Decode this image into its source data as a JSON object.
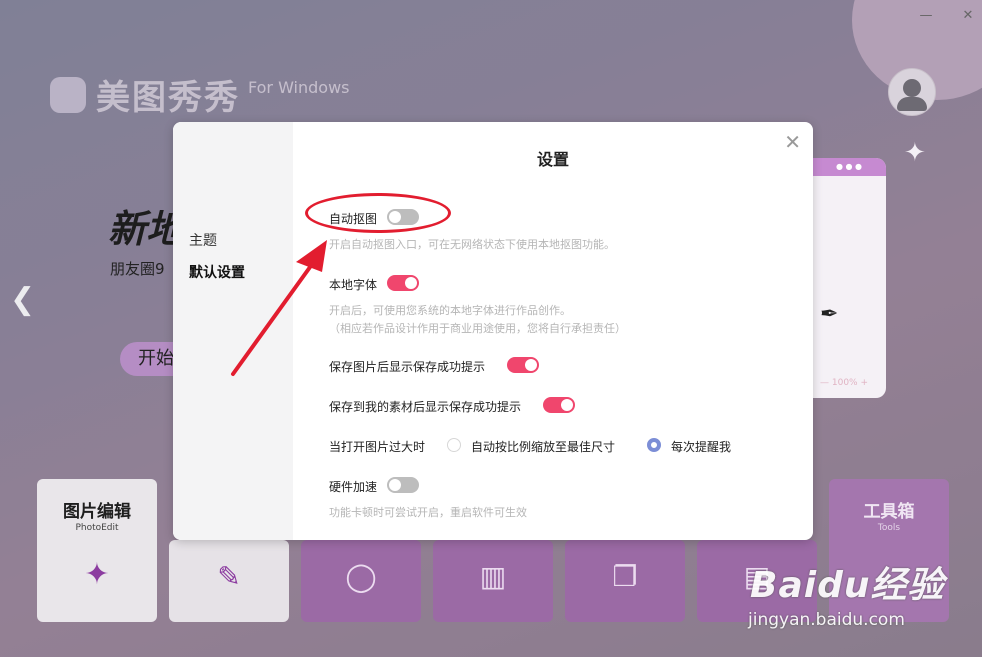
{
  "window": {
    "minimize_icon": "minimize-icon",
    "close_icon": "close-icon"
  },
  "app": {
    "logo_name": "美图秀秀",
    "logo_sub": "For Windows"
  },
  "banner": {
    "title": "新地",
    "subtitle": "朋友圈9",
    "start_button": "开始"
  },
  "preview": {
    "zoom_text": "— 100% +"
  },
  "tools": {
    "photo_edit_title": "图片编辑",
    "photo_edit_sub": "PhotoEdit",
    "toolbox_title": "工具箱",
    "toolbox_sub": "Tools"
  },
  "settings": {
    "title": "设置",
    "sidebar": [
      "主题",
      "默认设置"
    ],
    "auto_cutout_label": "自动抠图",
    "auto_cutout_on": false,
    "auto_cutout_desc": "开启自动抠图入口，可在无网络状态下使用本地抠图功能。",
    "local_font_label": "本地字体",
    "local_font_on": true,
    "local_font_desc1": "开启后，可使用您系统的本地字体进行作品创作。",
    "local_font_desc2": "（相应若作品设计作用于商业用途使用，您将自行承担责任）",
    "save_tip_label": "保存图片后显示保存成功提示",
    "save_tip_on": true,
    "material_tip_label": "保存到我的素材后显示保存成功提示",
    "material_tip_on": true,
    "large_image_label": "当打开图片过大时",
    "large_image_opt1": "自动按比例缩放至最佳尺寸",
    "large_image_opt2": "每次提醒我",
    "large_image_selected": "每次提醒我",
    "hw_accel_label": "硬件加速",
    "hw_accel_on": false,
    "hw_accel_desc": "功能卡顿时可尝试开启，重启软件可生效"
  },
  "watermark": {
    "main": "Baidu经验",
    "url": "jingyan.baidu.com"
  },
  "colors": {
    "toggle_on": "#f0466d",
    "annotation_red": "#e21d2f",
    "radio_selected": "#7c8ed6"
  }
}
